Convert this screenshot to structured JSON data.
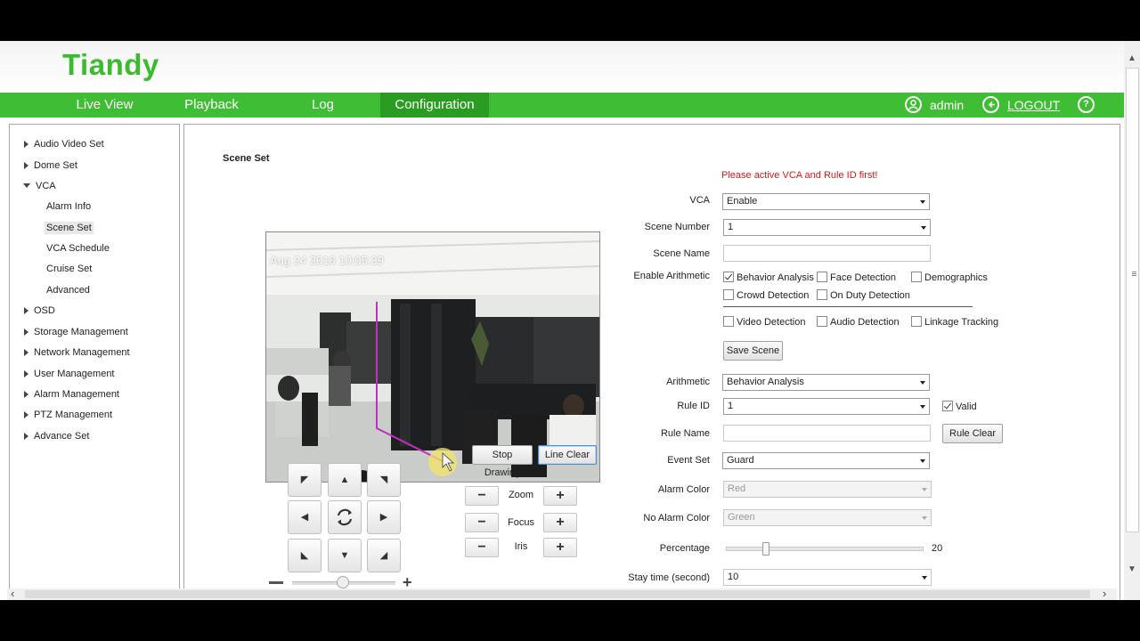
{
  "brand": {
    "logo": "Tiandy",
    "accent": "#3fbd34",
    "accent_dark": "#2b9c22"
  },
  "nav": {
    "items": [
      {
        "label": "Live View"
      },
      {
        "label": "Playback"
      },
      {
        "label": "Log"
      },
      {
        "label": "Configuration"
      }
    ],
    "user": "admin",
    "logout": "LOGOUT",
    "help_icon": "question-icon"
  },
  "sidebar": {
    "items": [
      {
        "label": "Audio Video Set"
      },
      {
        "label": "Dome Set"
      },
      {
        "label": "VCA"
      },
      {
        "label": "OSD"
      },
      {
        "label": "Storage Management"
      },
      {
        "label": "Network Management"
      },
      {
        "label": "User Management"
      },
      {
        "label": "Alarm Management"
      },
      {
        "label": "PTZ Management"
      },
      {
        "label": "Advance Set"
      }
    ],
    "vca_children": [
      {
        "label": "Alarm Info"
      },
      {
        "label": "Scene Set"
      },
      {
        "label": "VCA Schedule"
      },
      {
        "label": "Cruise Set"
      },
      {
        "label": "Advanced"
      }
    ]
  },
  "page": {
    "section_title": "Scene Set",
    "warning": "Please active VCA and Rule ID first!",
    "video_timestamp": "Aug 24 2016 10:05:39"
  },
  "form": {
    "vca_label": "VCA",
    "vca_value": "Enable",
    "scene_number_label": "Scene Number",
    "scene_number_value": "1",
    "scene_name_label": "Scene Name",
    "scene_name_value": "",
    "enable_arithmetic_label": "Enable Arithmetic",
    "arith_checks": [
      {
        "label": "Behavior Analysis",
        "checked": true
      },
      {
        "label": "Face Detection",
        "checked": false
      },
      {
        "label": "Demographics",
        "checked": false
      },
      {
        "label": "Crowd Detection",
        "checked": false
      },
      {
        "label": "On Duty Detection",
        "checked": false
      },
      {
        "label": "Video Detection",
        "checked": false
      },
      {
        "label": "Audio Detection",
        "checked": false
      },
      {
        "label": "Linkage Tracking",
        "checked": false
      }
    ],
    "save_scene": "Save Scene",
    "arithmetic_label": "Arithmetic",
    "arithmetic_value": "Behavior Analysis",
    "rule_id_label": "Rule ID",
    "rule_id_value": "1",
    "valid_label": "Valid",
    "valid_checked": true,
    "rule_name_label": "Rule Name",
    "rule_name_value": "",
    "rule_clear": "Rule Clear",
    "event_set_label": "Event Set",
    "event_set_value": "Guard",
    "alarm_color_label": "Alarm Color",
    "alarm_color_value": "Red",
    "no_alarm_color_label": "No Alarm Color",
    "no_alarm_color_value": "Green",
    "percentage_label": "Percentage",
    "percentage_value": "20",
    "percentage_fraction": 0.2,
    "stay_time_label": "Stay time (second)",
    "stay_time_value": "10"
  },
  "video_controls": {
    "stop_drawing": "Stop Drawing",
    "line_clear": "Line Clear",
    "zoom": "Zoom",
    "focus": "Focus",
    "iris": "Iris",
    "minus": "−",
    "plus": "+"
  }
}
